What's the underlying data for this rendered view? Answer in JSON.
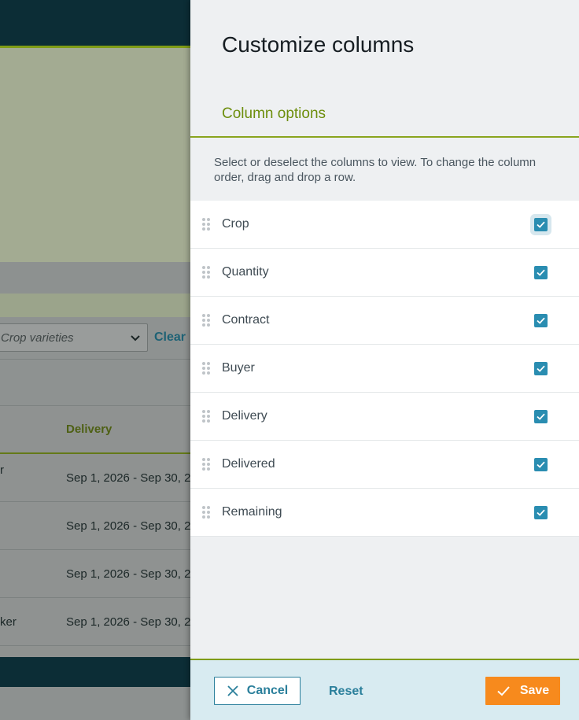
{
  "background": {
    "filter": {
      "select_placeholder": "Crop varieties",
      "clear_label": "Clear"
    },
    "table": {
      "delivery_header": "Delivery",
      "rows": [
        {
          "col0": "r",
          "delivery": "Sep 1, 2026 - Sep 30, 2"
        },
        {
          "col0": "",
          "delivery": "Sep 1, 2026 - Sep 30, 2"
        },
        {
          "col0": "",
          "delivery": "Sep 1, 2026 - Sep 30, 2"
        },
        {
          "col0": "ker",
          "delivery": "Sep 1, 2026 - Sep 30, 2"
        }
      ]
    }
  },
  "drawer": {
    "title": "Customize columns",
    "subtitle": "Column options",
    "instructions": "Select or deselect the columns to view. To change the column order, drag and drop a row.",
    "columns": [
      {
        "label": "Crop",
        "checked": true
      },
      {
        "label": "Quantity",
        "checked": true
      },
      {
        "label": "Contract",
        "checked": true
      },
      {
        "label": "Buyer",
        "checked": true
      },
      {
        "label": "Delivery",
        "checked": true
      },
      {
        "label": "Delivered",
        "checked": true
      },
      {
        "label": "Remaining",
        "checked": true
      }
    ],
    "footer": {
      "cancel_label": "Cancel",
      "reset_label": "Reset",
      "save_label": "Save"
    }
  },
  "colors": {
    "header_dark": "#0c2d36",
    "accent_green": "#7f9c16",
    "checkbox_blue": "#2a8db1",
    "link_blue": "#2a7f9b",
    "save_orange": "#f78a1d"
  },
  "icons": {
    "drag": "drag-handle-icon",
    "check": "check-icon",
    "cancel": "close-icon",
    "save": "check-icon",
    "select": "chevron-down-icon"
  }
}
